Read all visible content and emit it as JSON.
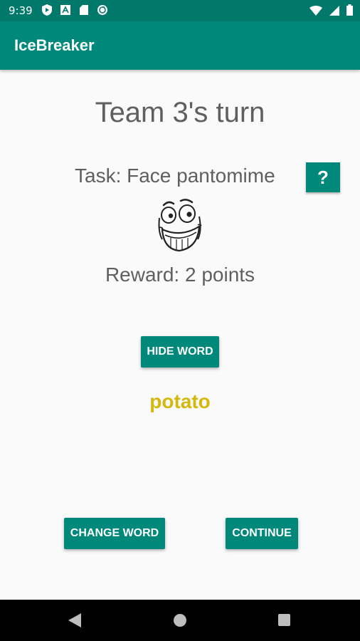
{
  "status_bar": {
    "time": "9:39",
    "left_icons": [
      "play-protect-icon",
      "font-icon",
      "sd-card-icon",
      "sync-icon"
    ],
    "right_icons": [
      "wifi-icon",
      "signal-icon",
      "battery-icon"
    ]
  },
  "app_bar": {
    "title": "IceBreaker",
    "color": "#00897b"
  },
  "game": {
    "team_title": "Team 3's turn",
    "task": "Task: Face pantomime",
    "help_label": "?",
    "reward": "Reward: 2 points",
    "hide_word_label": "HIDE WORD",
    "word": "potato",
    "word_color": "#d4b80e",
    "change_word_label": "CHANGE WORD",
    "continue_label": "CONTINUE"
  },
  "nav_bar": {
    "icons": [
      "back-icon",
      "home-icon",
      "recents-icon"
    ]
  }
}
